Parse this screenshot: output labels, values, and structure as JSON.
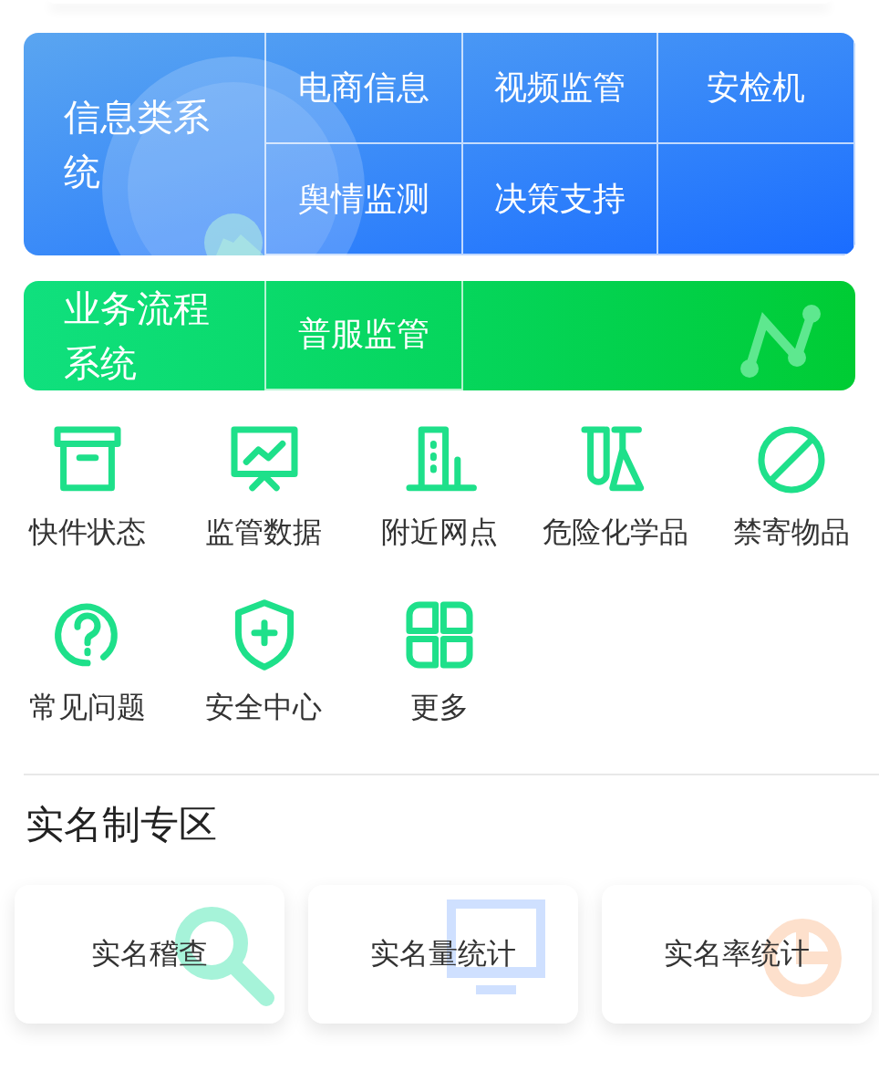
{
  "systems": [
    {
      "title": "信息类系统",
      "kind": "info",
      "cells": [
        "电商信息",
        "视频监管",
        "安检机",
        "舆情监测",
        "决策支持",
        ""
      ]
    },
    {
      "title": "业务流程系统",
      "kind": "process",
      "cells": [
        "普服监管",
        ""
      ]
    }
  ],
  "services": [
    {
      "label": "快件状态",
      "kind": "box"
    },
    {
      "label": "监管数据",
      "kind": "chart"
    },
    {
      "label": "附近网点",
      "kind": "building"
    },
    {
      "label": "危险化学品",
      "kind": "flask"
    },
    {
      "label": "禁寄物品",
      "kind": "ban"
    },
    {
      "label": "常见问题",
      "kind": "help"
    },
    {
      "label": "安全中心",
      "kind": "shield"
    },
    {
      "label": "更多",
      "kind": "more"
    }
  ],
  "real_name": {
    "title": "实名制专区",
    "cards": [
      {
        "label": "实名稽查",
        "kind": "search"
      },
      {
        "label": "实名量统计",
        "kind": "monitor"
      },
      {
        "label": "实名率统计",
        "kind": "pie"
      }
    ]
  }
}
